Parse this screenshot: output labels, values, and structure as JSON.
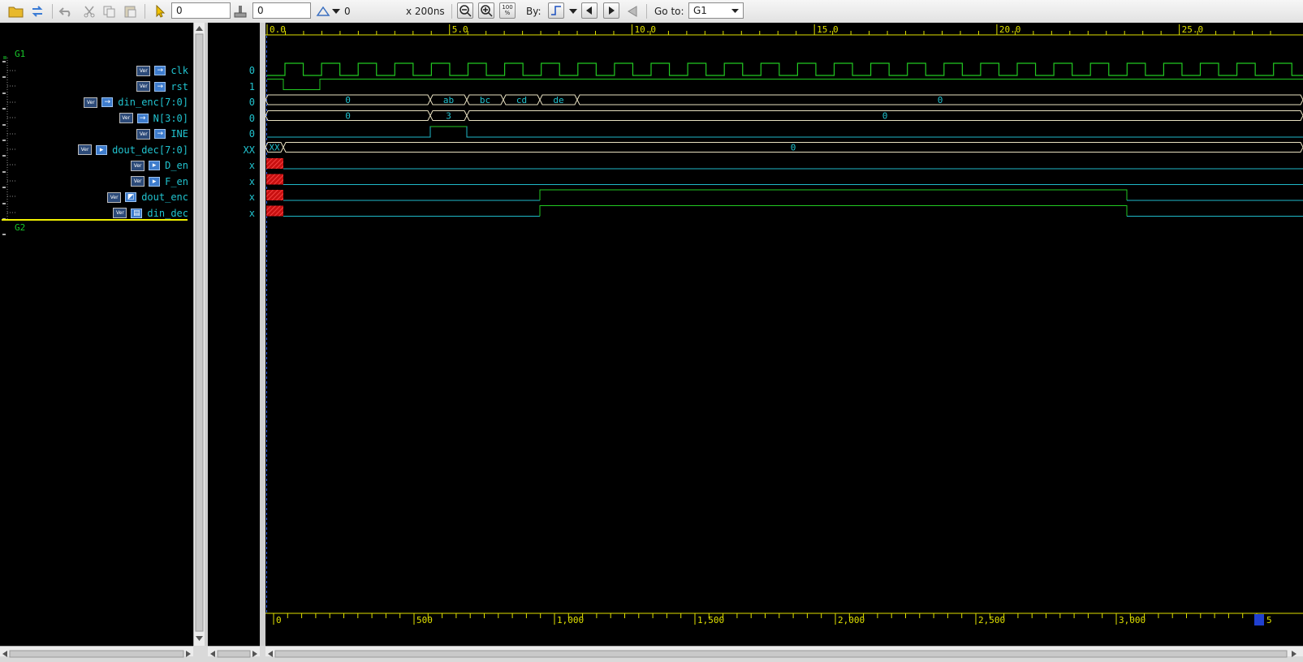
{
  "toolbar": {
    "cursor_value": "0",
    "time_value": "0",
    "delta_value": "0",
    "scale": "x 200ns",
    "zoom_fit_label": "100 %",
    "by_label": "By:",
    "goto_label": "Go to:",
    "goto_value": "G1",
    "icons": [
      "open-folder-icon",
      "reload-icon",
      "undo-icon",
      "cut-icon",
      "copy-icon",
      "paste-icon",
      "pointer-icon",
      "marker-icon",
      "delta-icon",
      "zoom-out-icon",
      "zoom-in-icon",
      "zoom-fit-icon",
      "edge-icon",
      "prev-icon",
      "next-icon",
      "goto-back-icon"
    ]
  },
  "groups": [
    {
      "label": "G1"
    },
    {
      "label": "G2"
    }
  ],
  "signals": [
    {
      "name": "clk",
      "value": "0",
      "badge": "Ver",
      "dir": "in"
    },
    {
      "name": "rst",
      "value": "1",
      "badge": "Ver",
      "dir": "in"
    },
    {
      "name": "din_enc[7:0]",
      "value": "0",
      "badge": "Ver",
      "dir": "in"
    },
    {
      "name": "N[3:0]",
      "value": "0",
      "badge": "Ver",
      "dir": "in"
    },
    {
      "name": "INE",
      "value": "0",
      "badge": "Ver",
      "dir": "in"
    },
    {
      "name": "dout_dec[7:0]",
      "value": "XX",
      "badge": "Ver",
      "dir": "out"
    },
    {
      "name": "D_en",
      "value": "x",
      "badge": "Ver",
      "dir": "out"
    },
    {
      "name": "F_en",
      "value": "x",
      "badge": "Ver",
      "dir": "out"
    },
    {
      "name": "dout_enc",
      "value": "x",
      "badge": "Ver",
      "dir": "reg"
    },
    {
      "name": "din_dec",
      "value": "x",
      "badge": "Ver",
      "dir": "wire"
    }
  ],
  "top_ruler": [
    "0.0",
    "5.0",
    "10.0",
    "15.0",
    "20.0",
    "25.0"
  ],
  "bottom_ruler": [
    "0",
    "500",
    "1,000",
    "1,500",
    "2,000",
    "2,500",
    "3,000",
    "5"
  ],
  "buses": {
    "din_enc": [
      "0",
      "ab",
      "bc",
      "cd",
      "de",
      "0"
    ],
    "N": [
      "0",
      "3",
      "0"
    ],
    "dout_dec": [
      "XX",
      "0"
    ]
  },
  "colors": {
    "background": "#000000",
    "name_text": "#21c3cf",
    "group_text": "#18c82a",
    "wave_low": "#1fb8c8",
    "wave_high": "#22c922",
    "bus": "#e8e0c0",
    "ruler": "#e0e000",
    "undefined": "#c81010"
  }
}
